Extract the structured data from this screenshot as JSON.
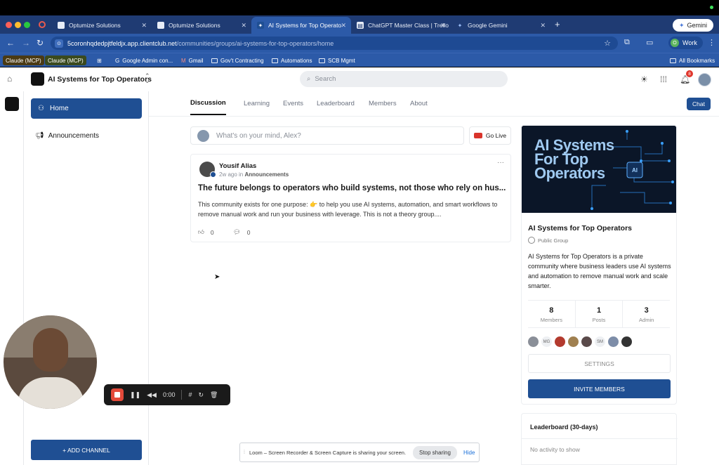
{
  "browser": {
    "tabs": [
      {
        "label": "Optumize Solutions"
      },
      {
        "label": "Optumize Solutions"
      },
      {
        "label": "AI Systems for Top Operato"
      },
      {
        "label": "ChatGPT Master Class | Trello"
      },
      {
        "label": "Google Gemini"
      }
    ],
    "gemini_label": "Gemini",
    "url_host": "5coronhqdedpjtfeldjx.app.clientclub.net",
    "url_path": "/communities/groups/ai-systems-for-top-operators/home",
    "profile_label": "Work",
    "profile_initial": "O",
    "bookmarks": [
      "Claude (MCP)",
      "Claude (MCP)",
      "Google Admin con...",
      "Gmail",
      "Gov't Contracting",
      "Automations",
      "SCB Mgmt"
    ],
    "all_bookmarks": "All Bookmarks"
  },
  "header": {
    "group_name": "AI Systems for Top Operators",
    "search_placeholder": "Search",
    "notif_count": "8"
  },
  "sidebar": {
    "home": "Home",
    "announcements": "Announcements",
    "add_channel": "+ ADD CHANNEL"
  },
  "tabs": [
    "Discussion",
    "Learning",
    "Events",
    "Leaderboard",
    "Members",
    "About"
  ],
  "chat_label": "Chat",
  "composer": {
    "placeholder": "What's on your mind, Alex?",
    "go_live": "Go Live"
  },
  "post": {
    "author": "Yousif Alias",
    "time": "2w ago",
    "in_word": "in",
    "channel": "Announcements",
    "title": "The future belongs to operators who build systems, not those who rely on hus...",
    "body": "This community exists for one purpose: 👉 to help you use AI systems, automation, and smart workflows to remove manual work and run your business with leverage. This is not a theory group....",
    "likes": "0",
    "comments": "0"
  },
  "group_card": {
    "banner_text_1": "AI Systems",
    "banner_text_2": "For Top",
    "banner_text_3": "Operators",
    "banner_chip": "AI",
    "name": "AI Systems for Top Operators",
    "type": "Public Group",
    "description": "AI Systems for Top Operators is a private community where business leaders use AI systems and automation to remove manual work and scale smarter.",
    "stats": [
      {
        "num": "8",
        "label": "Members"
      },
      {
        "num": "1",
        "label": "Posts"
      },
      {
        "num": "3",
        "label": "Admin"
      }
    ],
    "member_initials": [
      "",
      "MG",
      "",
      "",
      "",
      "SM",
      "",
      ""
    ],
    "settings": "SETTINGS",
    "invite": "INVITE MEMBERS"
  },
  "leaderboard": {
    "title": "Leaderboard (30-days)",
    "empty": "No activity to show"
  },
  "recorder": {
    "time": "0:00"
  },
  "loom": {
    "message": "Loom – Screen Recorder & Screen Capture is sharing your screen.",
    "stop": "Stop sharing",
    "hide": "Hide"
  },
  "colors": {
    "brand": "#1f4f93",
    "chrome_tabstrip": "#1f3b73",
    "chrome_active": "#2c5aa8",
    "record_red": "#e44a3a"
  }
}
